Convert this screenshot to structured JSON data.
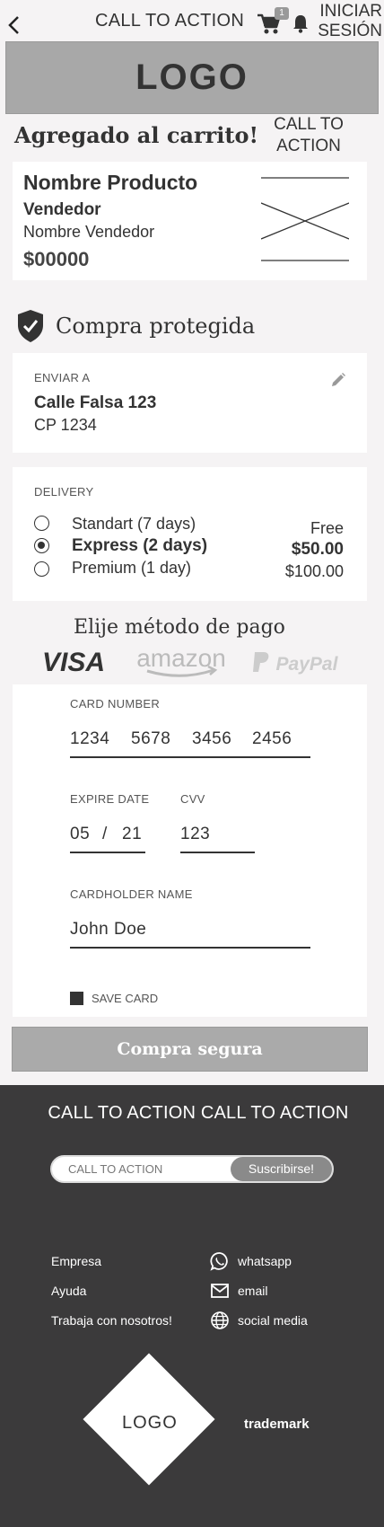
{
  "header": {
    "cta": "CALL TO ACTION",
    "cart_badge": "1",
    "login_line1": "INICIAR",
    "login_line2": "SESIÓN"
  },
  "logo": "LOGO",
  "added": {
    "title": "Agregado al carrito!",
    "cta_line1": "CALL TO",
    "cta_line2": "ACTION"
  },
  "product": {
    "name": "Nombre Producto",
    "seller_label": "Vendedor",
    "seller_name": "Nombre Vendedor",
    "price": "$00000"
  },
  "protected": "Compra protegida",
  "shipping": {
    "label": "ENVIAR A",
    "address": "Calle Falsa 123",
    "cp": "CP 1234"
  },
  "delivery": {
    "label": "DELIVERY",
    "options": [
      {
        "name": "Standart (7 days)",
        "price": "Free",
        "selected": false
      },
      {
        "name": "Express (2 days)",
        "price": "$50.00",
        "selected": true
      },
      {
        "name": "Premium (1 day)",
        "price": "$100.00",
        "selected": false
      }
    ]
  },
  "payment": {
    "title": "Elije método de pago",
    "methods": [
      "VISA",
      "amazon",
      "PayPal"
    ]
  },
  "form": {
    "card_number_label": "CARD NUMBER",
    "card_number": [
      "1234",
      "5678",
      "3456",
      "2456"
    ],
    "expire_label": "EXPIRE DATE",
    "expire_month": "05",
    "expire_sep": "/",
    "expire_year": "21",
    "cvv_label": "CVV",
    "cvv": "123",
    "holder_label": "CARDHOLDER NAME",
    "holder": "John Doe",
    "save_label": "SAVE CARD"
  },
  "buy_button": "Compra segura",
  "footer": {
    "cta": "CALL TO ACTION CALL TO ACTION",
    "subscribe_placeholder": "CALL TO ACTION",
    "subscribe_button": "Suscribirse!",
    "links": [
      "Empresa",
      "Ayuda",
      "Trabaja con nosotros!"
    ],
    "contacts": [
      "whatsapp",
      "email",
      "social media"
    ],
    "logo": "LOGO",
    "trademark": "trademark"
  },
  "colors": {
    "background": "#f5f3f4",
    "footer": "#3b3a3b",
    "button": "#aaaaaa",
    "text": "#333333"
  }
}
